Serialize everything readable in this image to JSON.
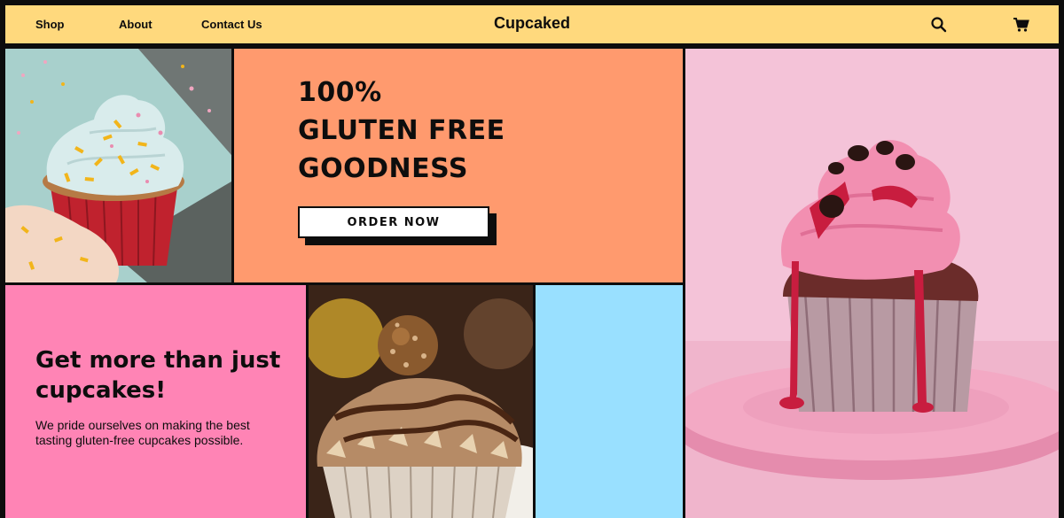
{
  "nav": {
    "links": [
      "Shop",
      "About",
      "Contact Us"
    ],
    "brand": "Cupcaked",
    "icons": [
      "search-icon",
      "cart-icon"
    ]
  },
  "hero": {
    "title_lines": [
      "100%",
      "GLUTEN FREE",
      "GOODNESS"
    ],
    "button_label": "ORDER NOW"
  },
  "promo": {
    "heading": "Get more than just cupcakes!",
    "text": "We pride ourselves on making the best tasting gluten-free cupcakes possible."
  },
  "images": [
    "sprinkle-cupcake-photo",
    "chocolate-hazelnut-cupcake-photo",
    "red-velvet-cupcake-photo"
  ],
  "colors": {
    "background": "#0d0d0d",
    "nav": "#ffd97d",
    "hero": "#ff9a6e",
    "promo": "#ff84b5",
    "blue_block": "#99e0ff",
    "pink_photo_bg": "#f3c0d6"
  }
}
